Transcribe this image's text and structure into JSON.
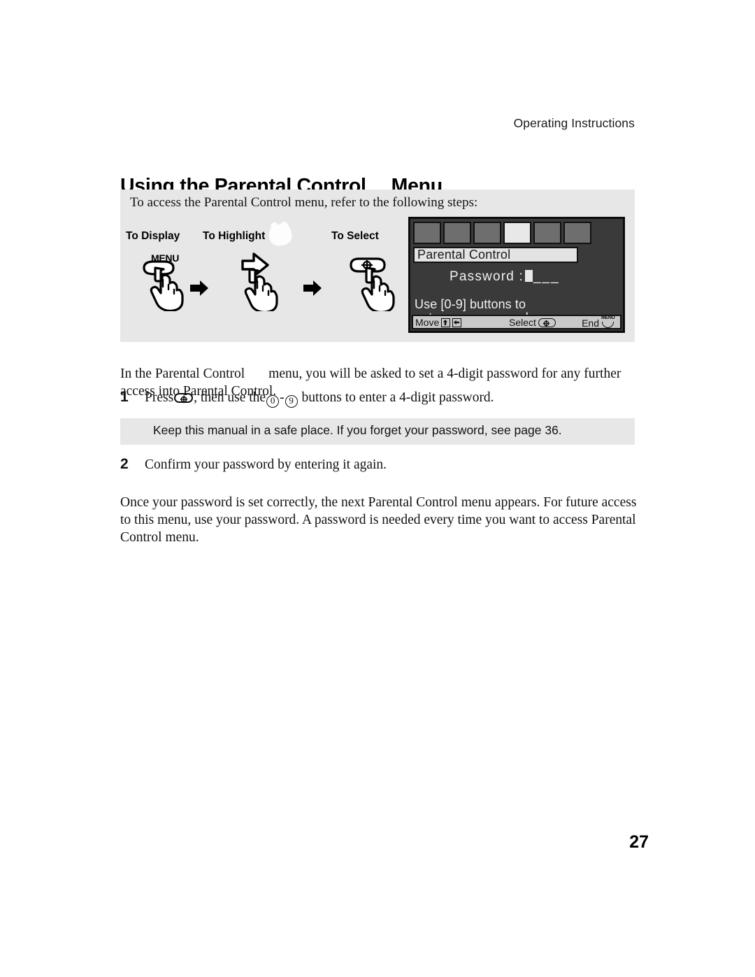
{
  "page": {
    "running_header": "Operating Instructions",
    "folio": "27"
  },
  "title": {
    "before_mark": "Using the Parental Control",
    "after_mark": "Menu"
  },
  "intro_panel": {
    "lead": "To access the Parental Control menu, refer to the following steps:",
    "steps": [
      {
        "label": "To Display",
        "icon": "menu-button-press-hand",
        "button_caption": "MENU"
      },
      {
        "label": "To Highlight",
        "icon": "arrow-button-press-hand"
      },
      {
        "label": "To Select",
        "icon": "select-button-press-hand"
      }
    ],
    "arrow_separator": "right-arrow"
  },
  "tv_osd": {
    "tabs": [
      {
        "active": false
      },
      {
        "active": false
      },
      {
        "active": false
      },
      {
        "active": true
      },
      {
        "active": false
      },
      {
        "active": false
      }
    ],
    "menu_title": "Parental Control",
    "password_label": "Password :",
    "password_blanks": "___",
    "hint_line1": "Use [0-9] buttons to",
    "hint_line2": "enter new password",
    "footer": {
      "move_label": "Move",
      "move_icon_1": "up-arrow-button-icon",
      "move_icon_2": "left-arrow-button-icon",
      "select_label": "Select",
      "select_icon": "select-plus-button-icon",
      "end_label": "End",
      "end_icon": "menu-button-icon",
      "end_icon_caption": "MENU"
    },
    "colors": {
      "screen_bg": "#3a3a3a",
      "tab_inactive": "#6e6e6e",
      "tab_active": "#e8e8e8",
      "titlebar_bg": "#e3e3e3",
      "footer_bg": "#c9c9c9",
      "text_light": "#f2f2f2"
    }
  },
  "body": {
    "intro_before_mark": "In the Parental Control",
    "intro_after_mark": "menu, you will be asked to set a 4-digit password for any further access into Parental Control.",
    "step1": {
      "number": "1",
      "text_a": "Press",
      "glyph_select": "select-plus-button-icon",
      "text_b": ", then use the",
      "glyph_zero": "0",
      "glyph_dash": "-",
      "glyph_nine": "9",
      "text_c": "buttons to enter a 4-digit password."
    },
    "note": "Keep this manual in a safe place. If you forget your password, see page 36.",
    "step2": {
      "number": "2",
      "text": "Confirm your password by entering it again."
    },
    "outro": "Once your password is set correctly, the next Parental Control menu appears. For future access to this menu, use your password. A password is needed every time you want to access Parental Control menu."
  }
}
